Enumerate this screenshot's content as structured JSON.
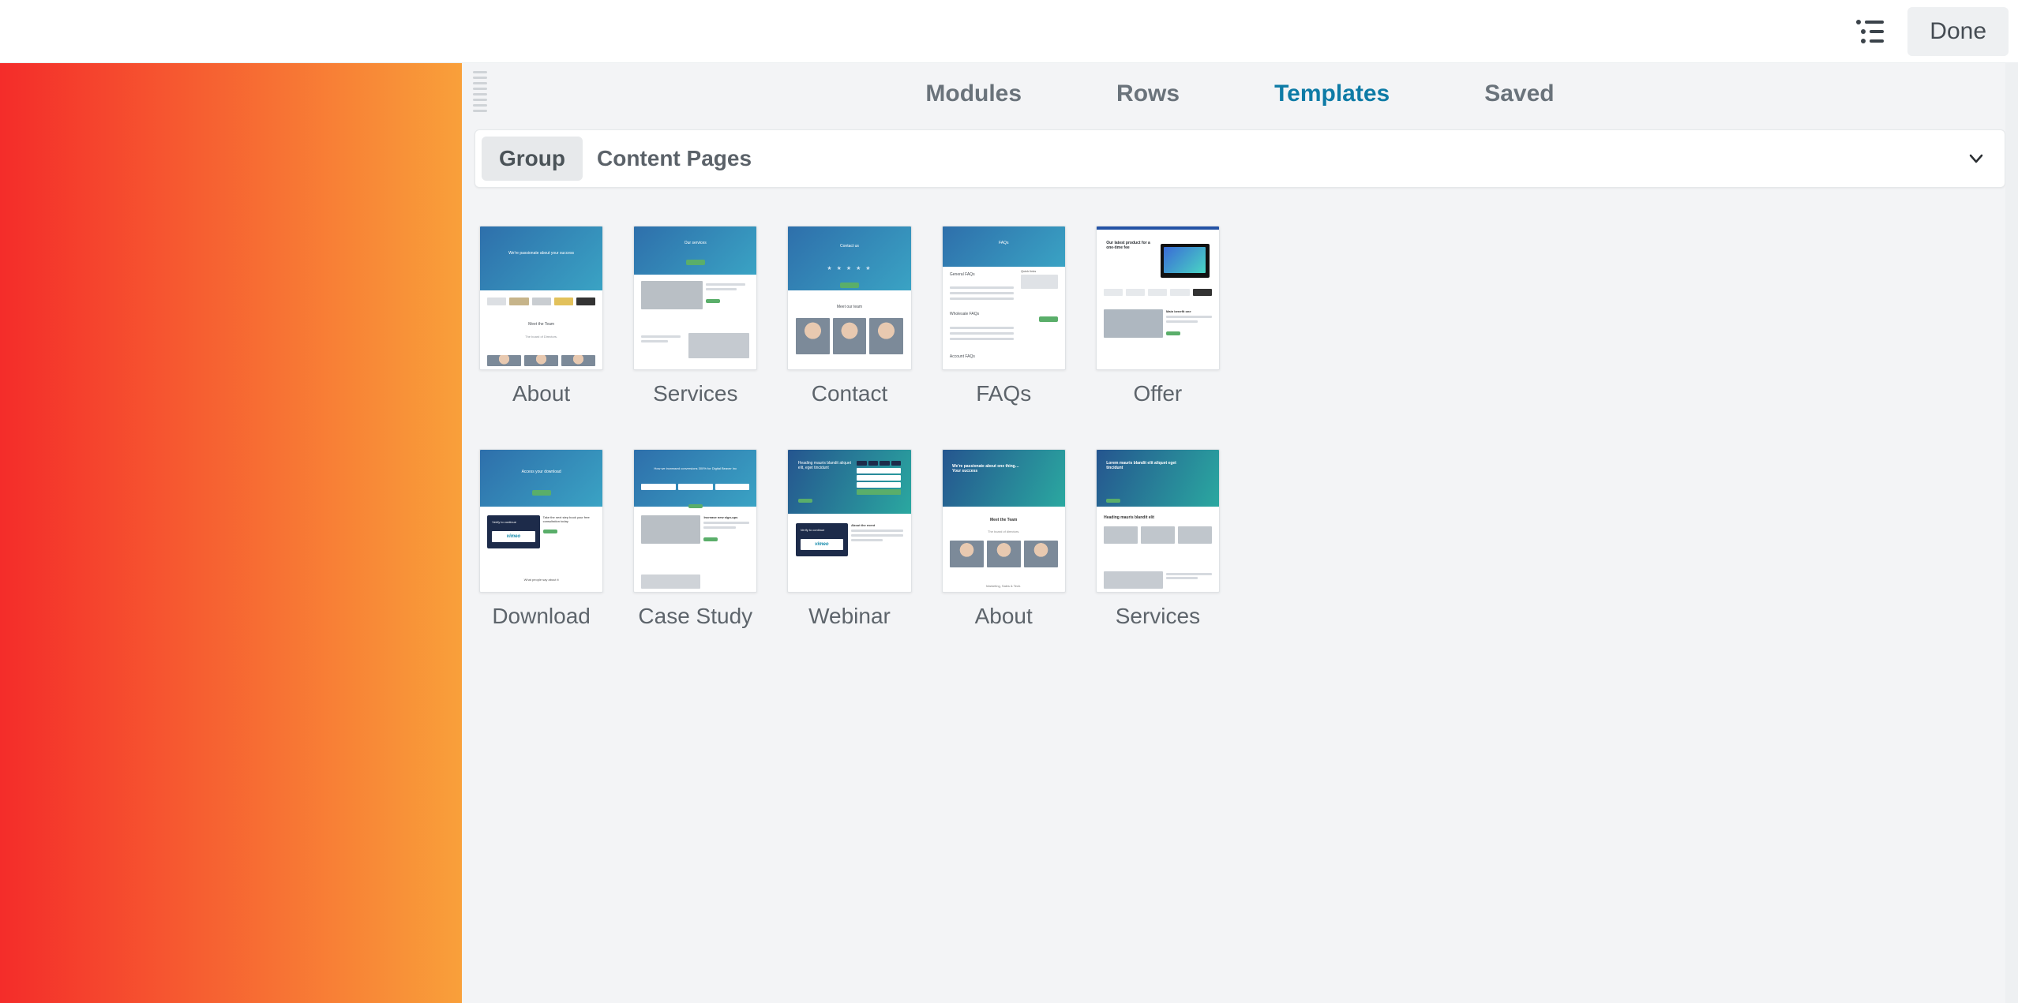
{
  "topbar": {
    "done_label": "Done",
    "outline_icon": "outline"
  },
  "panel": {
    "tabs": {
      "modules": "Modules",
      "rows": "Rows",
      "templates": "Templates",
      "saved": "Saved",
      "active": "templates"
    },
    "group_filter": {
      "label": "Group",
      "value": "Content Pages"
    },
    "templates": [
      {
        "label": "About"
      },
      {
        "label": "Services"
      },
      {
        "label": "Contact"
      },
      {
        "label": "FAQs"
      },
      {
        "label": "Offer"
      },
      {
        "label": "Download"
      },
      {
        "label": "Case Study"
      },
      {
        "label": "Webinar"
      },
      {
        "label": "About"
      },
      {
        "label": "Services"
      }
    ]
  }
}
